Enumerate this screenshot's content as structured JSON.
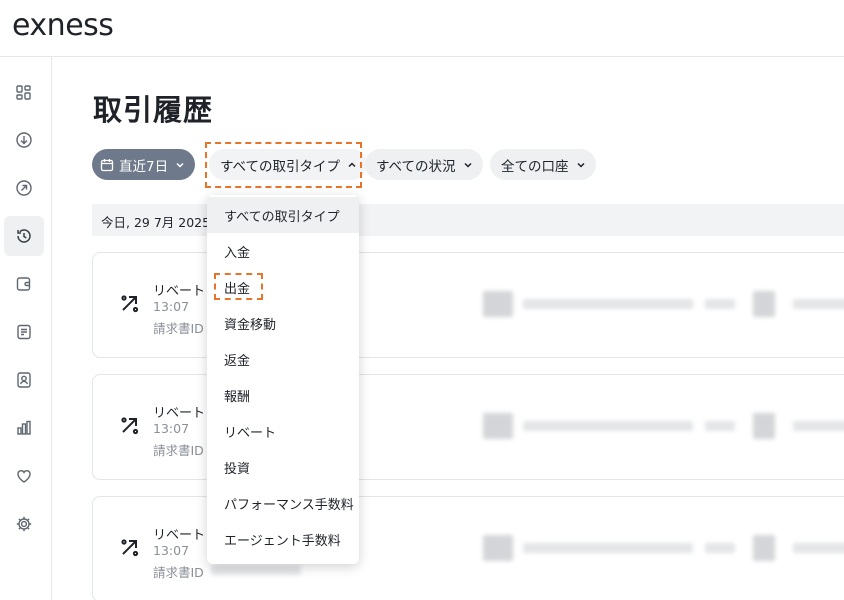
{
  "brand": {
    "logo_text": "exness",
    "accent_color": "#e8742a",
    "chip_active_color": "#6e7a8c"
  },
  "sidebar": {
    "items": [
      {
        "icon": "dashboard-icon",
        "active": false
      },
      {
        "icon": "deposit-icon",
        "active": false
      },
      {
        "icon": "withdraw-icon",
        "active": false
      },
      {
        "icon": "history-icon",
        "active": true
      },
      {
        "icon": "wallet-icon",
        "active": false
      },
      {
        "icon": "document-icon",
        "active": false
      },
      {
        "icon": "account-icon",
        "active": false
      },
      {
        "icon": "analytics-icon",
        "active": false
      },
      {
        "icon": "favorites-icon",
        "active": false
      },
      {
        "icon": "settings-icon",
        "active": false
      }
    ]
  },
  "page": {
    "title": "取引履歴"
  },
  "filters": {
    "date": "直近7日",
    "type": "すべての取引タイプ",
    "status": "すべての状況",
    "account": "全ての口座"
  },
  "date_group": "今日, 29 7月 2025",
  "transactions": [
    {
      "type": "リベート",
      "time": "13:07",
      "invoice_label": "請求書ID"
    },
    {
      "type": "リベート",
      "time": "13:07",
      "invoice_label": "請求書ID"
    },
    {
      "type": "リベート",
      "time": "13:07",
      "invoice_label": "請求書ID"
    }
  ],
  "dropdown": {
    "selected_index": 0,
    "highlighted_index": 2,
    "options": [
      "すべての取引タイプ",
      "入金",
      "出金",
      "資金移動",
      "返金",
      "報酬",
      "リベート",
      "投資",
      "パフォーマンス手数料",
      "エージェント手数料"
    ]
  }
}
